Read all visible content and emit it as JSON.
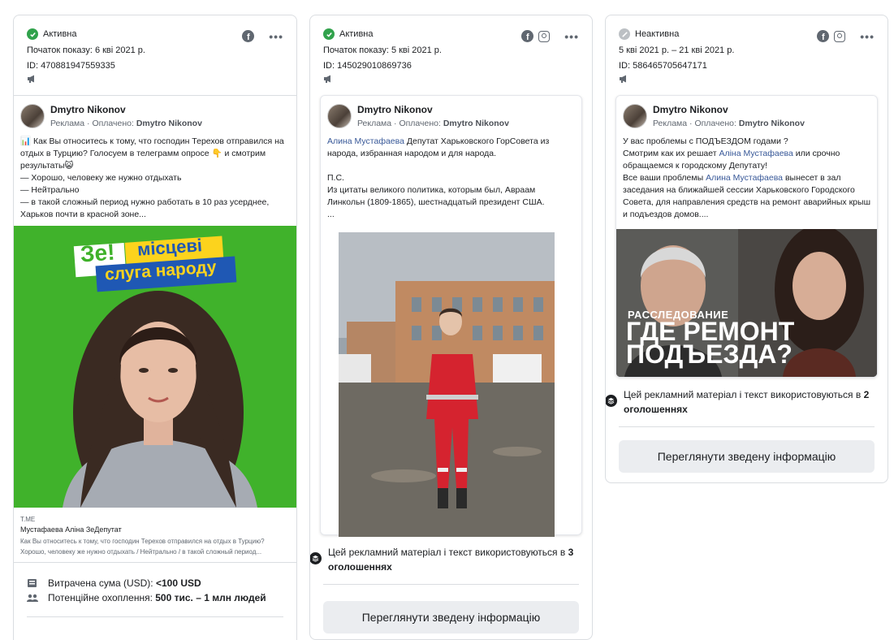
{
  "cards": [
    {
      "status": "Активна",
      "shown": "Початок показу: 6 кві 2021 р.",
      "id": "ID: 470881947559335",
      "author": "Dmytro Nikonov",
      "sponsored_prefix": "Реклама · Оплачено: ",
      "sponsor": "Dmytro Nikonov",
      "text": "📊 Как Вы относитесь к тому, что господин Терехов отправился на отдых в Турцию? Голосуем в телеграмм опросе 👇 и смотрим результаты😺\n— Хорошо, человеку же нужно отдыхать\n— Нейтрально\n— в такой сложный период нужно работать в 10 раз усерднее, Харьков почти в красной зоне...",
      "image_heading_1": "Зе!",
      "image_heading_2": "місцеві",
      "image_heading_3": "слуга народу",
      "link_domain": "T.ME",
      "link_title": "Мустафаева Аліна ЗеДепутат",
      "link_desc": "Как Вы относитесь к тому, что господин Терехов отправился на отдых в Турцию? Хорошо, человеку же нужно отдыхать / Нейтрально / в такой сложный период...",
      "spent_label": "Витрачена сума (USD): ",
      "spent_value": "<100 USD",
      "reach_label": "Потенційне охоплення: ",
      "reach_value": "500 тис. – 1 млн людей"
    },
    {
      "status": "Активна",
      "shown": "Початок показу: 5 кві 2021 р.",
      "id": "ID: 145029010869736",
      "author": "Dmytro Nikonov",
      "sponsored_prefix": "Реклама · Оплачено: ",
      "sponsor": "Dmytro Nikonov",
      "text_link": "Алина Мустафаева",
      "text": " Депутат Харьковского ГорСовета из народа, избранная народом и для народа.\n\nП.С.\nИз цитаты великого политика, которым был, Авраам Линкольн (1809-1865), шестнадцатый президент США.\n...",
      "used_text": "Цей рекламний матеріал і текст використовуються в ",
      "used_count": "3 оголошеннях",
      "button": "Переглянути зведену інформацію"
    },
    {
      "status": "Неактивна",
      "shown": "5 кві 2021 р. – 21 кві 2021 р.",
      "id": "ID: 586465705647171",
      "author": "Dmytro Nikonov",
      "sponsored_prefix": "Реклама · Оплачено: ",
      "sponsor": "Dmytro Nikonov",
      "text_a": "У вас проблемы с ПОДЪЕЗДОМ годами ?\nСмотрим как их решает ",
      "text_link1": "Аліна Мустафаева",
      "text_b": " или срочно обращаемся к городскому Депутату!\nВсе ваши проблемы ",
      "text_link2": "Алина Мустафаева",
      "text_c": " вынесет в зал заседания на ближайшей сессии Харьковского Городского Совета, для направления средств на ремонт аварийных крыш и подъездов домов....",
      "image_caption_1": "РАССЛЕДОВАНИЕ",
      "image_caption_2": "ГДЕ РЕМОНТ",
      "image_caption_3": "ПОДЪЕЗДА?",
      "used_text": "Цей рекламний матеріал і текст використовуються в ",
      "used_count": "2 оголошеннях",
      "button": "Переглянути зведену інформацію"
    }
  ],
  "icons": {
    "active_color": "#31a24c",
    "inactive_color": "#bcc0c4",
    "link_color": "#385898"
  }
}
